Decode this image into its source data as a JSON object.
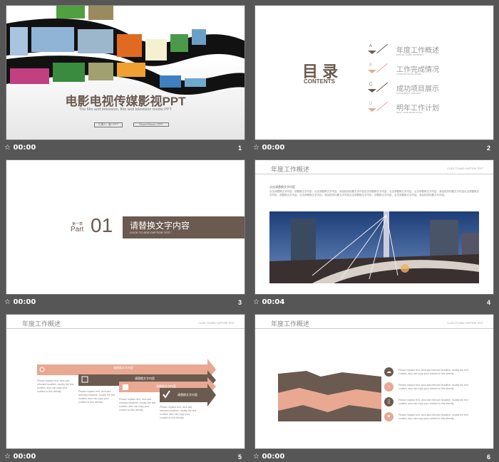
{
  "slides": [
    {
      "number": "1",
      "time": "00:00",
      "title": "电影电视传媒影视PPT",
      "subtitle": "The film and television, film and television media PPT",
      "reporter": "汇报人：墨一PPT",
      "report_person": "Report Person: 1PPT"
    },
    {
      "number": "2",
      "time": "00:00",
      "title": "目 录",
      "title_en": "CONTENTS",
      "items": [
        {
          "letter": "A",
          "label": "年度工作概述",
          "sub": "ANNUAL WORK SUMMARY"
        },
        {
          "letter": "B",
          "label": "工作完成情况",
          "sub": "COMPLETION OF WORK"
        },
        {
          "letter": "C",
          "label": "成功项目展示",
          "sub": "SUCCESSFUL PROJECT"
        },
        {
          "letter": "D",
          "label": "明年工作计划",
          "sub": "NEXT YEAR WORK PLAN"
        }
      ]
    },
    {
      "number": "3",
      "time": "00:00",
      "chapter": "第一章",
      "part": "Part",
      "part_num": "01",
      "heading": "请替换文字内容",
      "caption": "CLICK TO ADD CAPTION TEXT"
    },
    {
      "number": "4",
      "time": "00:04",
      "header": "年度工作概述",
      "header_right": "CLICK TO ADD CAPTION TEXT",
      "body_title": "点击请替换文字内容",
      "body_text": "点击请替换文字内容，请替换文字内容，点击请替换文字内容，添加相关标题文字内容点击请替换文字内容，点击请替换文字内容，点击请替换文字内容，添加相关标题文字内容点击请替换文字内容，请替换文字内容，点击请替换文字内容，添加相关标题文字内容点击请替换文字内容，请替换文字内容，点击请替换文字内容，添加相关标题文字内容。"
    },
    {
      "number": "5",
      "time": "00:00",
      "header": "年度工作概述",
      "header_right": "CLICK TO ADD CAPTION TEXT",
      "arrow_label": "请替换文字内容",
      "desc": "Please replace text, click add relevant headline, modify the text content, also can copy your content to this directly."
    },
    {
      "number": "6",
      "time": "00:00",
      "header": "年度工作概述",
      "header_right": "CLICK TO ADD CAPTION TEXT",
      "desc": "Please replace text, click add relevant headline, modify the text content, also can copy your content to this directly."
    }
  ],
  "colors": {
    "brown": "#6b5a50",
    "pink": "#e8a892",
    "background": "#565656"
  },
  "icons": {
    "footer": "star-transition-icon"
  }
}
